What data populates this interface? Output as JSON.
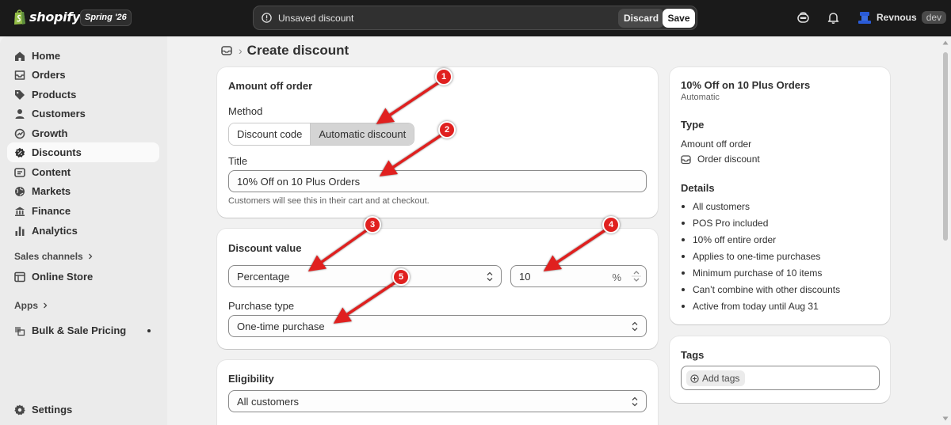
{
  "topbar": {
    "logo_text": "shopify",
    "edition": "Spring '26",
    "savebar_message": "Unsaved discount",
    "discard_label": "Discard",
    "save_label": "Save",
    "user_name": "Revnous",
    "user_env": "dev"
  },
  "sidebar": {
    "items": [
      {
        "label": "Home",
        "icon": "home-icon"
      },
      {
        "label": "Orders",
        "icon": "orders-icon"
      },
      {
        "label": "Products",
        "icon": "tag-icon"
      },
      {
        "label": "Customers",
        "icon": "person-icon"
      },
      {
        "label": "Growth",
        "icon": "growth-icon"
      },
      {
        "label": "Discounts",
        "icon": "discount-icon",
        "active": true
      },
      {
        "label": "Content",
        "icon": "content-icon"
      },
      {
        "label": "Markets",
        "icon": "globe-icon"
      },
      {
        "label": "Finance",
        "icon": "bank-icon"
      },
      {
        "label": "Analytics",
        "icon": "bar-chart-icon"
      }
    ],
    "sales_channels_label": "Sales channels",
    "online_store_label": "Online Store",
    "apps_label": "Apps",
    "bulk_pricing_label": "Bulk & Sale Pricing",
    "settings_label": "Settings"
  },
  "breadcrumb": {
    "title": "Create discount"
  },
  "amount_card": {
    "title": "Amount off order",
    "method_label": "Method",
    "method_options": [
      "Discount code",
      "Automatic discount"
    ],
    "selected_method": "Automatic discount",
    "title_label": "Title",
    "title_value": "10% Off on 10 Plus Orders",
    "title_help": "Customers will see this in their cart and at checkout."
  },
  "value_card": {
    "title": "Discount value",
    "type_value": "Percentage",
    "amount_value": "10",
    "amount_suffix": "%",
    "purchase_type_label": "Purchase type",
    "purchase_type_value": "One-time purchase"
  },
  "eligibility_card": {
    "title": "Eligibility",
    "value": "All customers"
  },
  "summary": {
    "title": "10% Off on 10 Plus Orders",
    "subtitle": "Automatic",
    "type_heading": "Type",
    "type_value": "Amount off order",
    "type_detail": "Order discount",
    "details_heading": "Details",
    "details": [
      "All customers",
      "POS Pro included",
      "10% off entire order",
      "Applies to one-time purchases",
      "Minimum purchase of 10 items",
      "Can’t combine with other discounts",
      "Active from today until Aug 31"
    ]
  },
  "tags": {
    "heading": "Tags",
    "add_label": "Add tags"
  },
  "annotations": {
    "numbers": [
      "1",
      "2",
      "3",
      "4",
      "5"
    ],
    "color": "#e0201f"
  },
  "colors": {
    "topbar": "#1a1a1a",
    "sidebar": "#ebebeb",
    "page": "#f1f1f1",
    "selected_segment": "#d4d4d4"
  }
}
